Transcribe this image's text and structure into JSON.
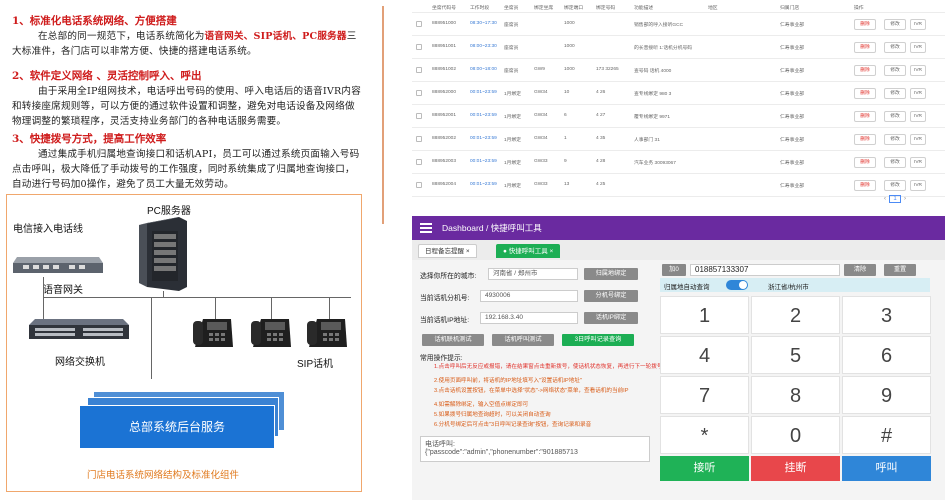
{
  "left": {
    "s1_title": "1、标准化电话系统网络、方便搭建",
    "s1_body_pre": "在总部的同一规范下，电话系统简化为",
    "s1_highlight": "语音网关、SIP话机、PC服务器",
    "s1_body_post": "三大标准件，各门店可以非常方便、快捷的搭建电话系统。",
    "s2_title": "2、软件定义网络 、灵活控制呼入、呼出",
    "s2_body": "由于采用全IP组网技术，电话呼出号码的使用、呼入电话后的语音IVR内容和转接座席规则等，可以方便的通过软件设置和调整，避免对电话设备及网络做物理调整的繁琐程序，灵活支持业务部门的各种电话服务需要。",
    "s3_title": "3、快捷拨号方式，提高工作效率",
    "s3_body": "通过集成手机归属地查询接口和话机API，员工可以通过系统页面输入号码点击呼叫，极大降低了手动拨号的工作强度，同时系统集成了归属地查询接口，自动进行号码加0操作，避免了员工大量无效劳动。",
    "diagram": {
      "telecom": "电信接入电话线",
      "pc_server": "PC服务器",
      "gateway": "语音网关",
      "switch": "网络交换机",
      "sip_phone": "SIP话机",
      "backend": "总部系统后台服务",
      "caption": "门店电话系统网络结构及标准化组件"
    }
  },
  "table": {
    "headers": [
      "坐席代码号",
      "工作时段",
      "坐席员",
      "绑定坐席",
      "绑定端口",
      "绑定号码",
      "功能描述",
      "地区",
      "归属门店",
      "操作"
    ],
    "rows": [
      {
        "code": "888951000",
        "time": "08:30~17:30",
        "team": "座席员",
        "bind": "",
        "port": "1000",
        "num": "",
        "desc": "销售部的呼入接听GCC",
        "area": "",
        "store": "仁寿事业部",
        "btns": [
          "删除",
          "修改",
          "IVR"
        ]
      },
      {
        "code": "888951001",
        "time": "08:00~23:30",
        "team": "座席员",
        "bind": "",
        "port": "1000",
        "num": "",
        "desc": "的长音接听 1:话机分机号码",
        "area": "",
        "store": "仁寿事业部",
        "btns": [
          "删除",
          "修改",
          "IVR"
        ]
      },
      {
        "code": "888951002",
        "time": "08:00~18:00",
        "team": "座席员",
        "bind": "GW9",
        "port": "1000",
        "num": "173 32265",
        "desc": "查号码 话机 4000",
        "area": "",
        "store": "仁寿事业部",
        "btns": [
          "删除",
          "修改",
          "IVR"
        ]
      },
      {
        "code": "888952000",
        "time": "00:01~23:59",
        "team": "1月绑定",
        "bind": "GW34",
        "port": "10",
        "num": "4 26",
        "desc": "查专线绑定 980 3",
        "area": "",
        "store": "仁寿事业部",
        "btns": [
          "删除",
          "修改",
          "IVR"
        ]
      },
      {
        "code": "888952001",
        "time": "00:01~23:59",
        "team": "1月绑定",
        "bind": "GW34",
        "port": "6",
        "num": "4 27",
        "desc": "覆专线绑定 9971",
        "area": "",
        "store": "仁寿事业部",
        "btns": [
          "删除",
          "修改",
          "IVR"
        ]
      },
      {
        "code": "888952002",
        "time": "00:01~23:59",
        "team": "1月绑定",
        "bind": "GW34",
        "port": "1",
        "num": "4 35",
        "desc": "人事部门 31",
        "area": "",
        "store": "仁寿事业部",
        "btns": [
          "删除",
          "修改",
          "IVR"
        ]
      },
      {
        "code": "888952003",
        "time": "00:01~23:59",
        "team": "1月绑定",
        "bind": "GW33",
        "port": "9",
        "num": "4 28",
        "desc": "汽车业务 30093067",
        "area": "",
        "store": "仁寿事业部",
        "btns": [
          "删除",
          "修改",
          "IVR"
        ]
      },
      {
        "code": "888952004",
        "time": "00:01~23:59",
        "team": "1月绑定",
        "bind": "GW33",
        "port": "13",
        "num": "4 25",
        "desc": "",
        "area": "",
        "store": "仁寿事业部",
        "btns": [
          "删除",
          "修改",
          "IVR"
        ]
      }
    ],
    "pager_prev": "‹",
    "pager_page": "1",
    "pager_next": "›"
  },
  "dialer": {
    "crumb_home": "Dashboard",
    "crumb_sep": "/",
    "crumb_page": "快捷呼叫工具",
    "tab1": "日程备忘提醒",
    "tab1_x": "×",
    "tab2": "快捷呼叫工具",
    "tab2_x": "×",
    "city_label": "选择你所在的城市:",
    "city_value": "河南省 / 郑州市",
    "city_btn": "归属地绑定",
    "ext_label": "当前话机分机号:",
    "ext_value": "4930006",
    "ext_btn": "分机号绑定",
    "ip_label": "当前话机IP地址:",
    "ip_value": "192.168.3.40",
    "ip_btn": "话机IP绑定",
    "btn_test1": "话机联机测试",
    "btn_test2": "话机呼叫测试",
    "btn_records": "3日呼叫记录查询",
    "tips_title": "常用操作提示:",
    "tips": [
      "1.点击呼叫后无反应或报错，请在结果窗点击重新拨号，使话机状态恢复，再进行下一轮拨号",
      "2.使用页面呼叫前，将话机的IP地址填写入\"设置话机IP地址\"",
      "3.点击话机设置按钮，在菜单中选择\"状态\"->网络状态\"菜单，查看话机的当前IP",
      "4.如需解除绑定，输入空值点绑定即可",
      "5.如果拨号归属地查询超时，可以关闭自动查询",
      "6.分机号绑定后可点击\"3日呼叫记录查询\"按钮，查询记录和录音"
    ],
    "log_label": "电话呼叫:",
    "log_value": "{\"passcode\":\"admin\",\"phonenumber\":\"901885713",
    "add0_btn": "加0",
    "phone_value": "018857133307",
    "clear_btn": "清除",
    "reset_btn": "重置",
    "auto_label": "归属地自动查询",
    "location": "浙江省/杭州市",
    "keys": [
      "1",
      "2",
      "3",
      "4",
      "5",
      "6",
      "7",
      "8",
      "9",
      "*",
      "0",
      "#"
    ],
    "answer": "接听",
    "hangup": "挂断",
    "call": "呼叫"
  }
}
